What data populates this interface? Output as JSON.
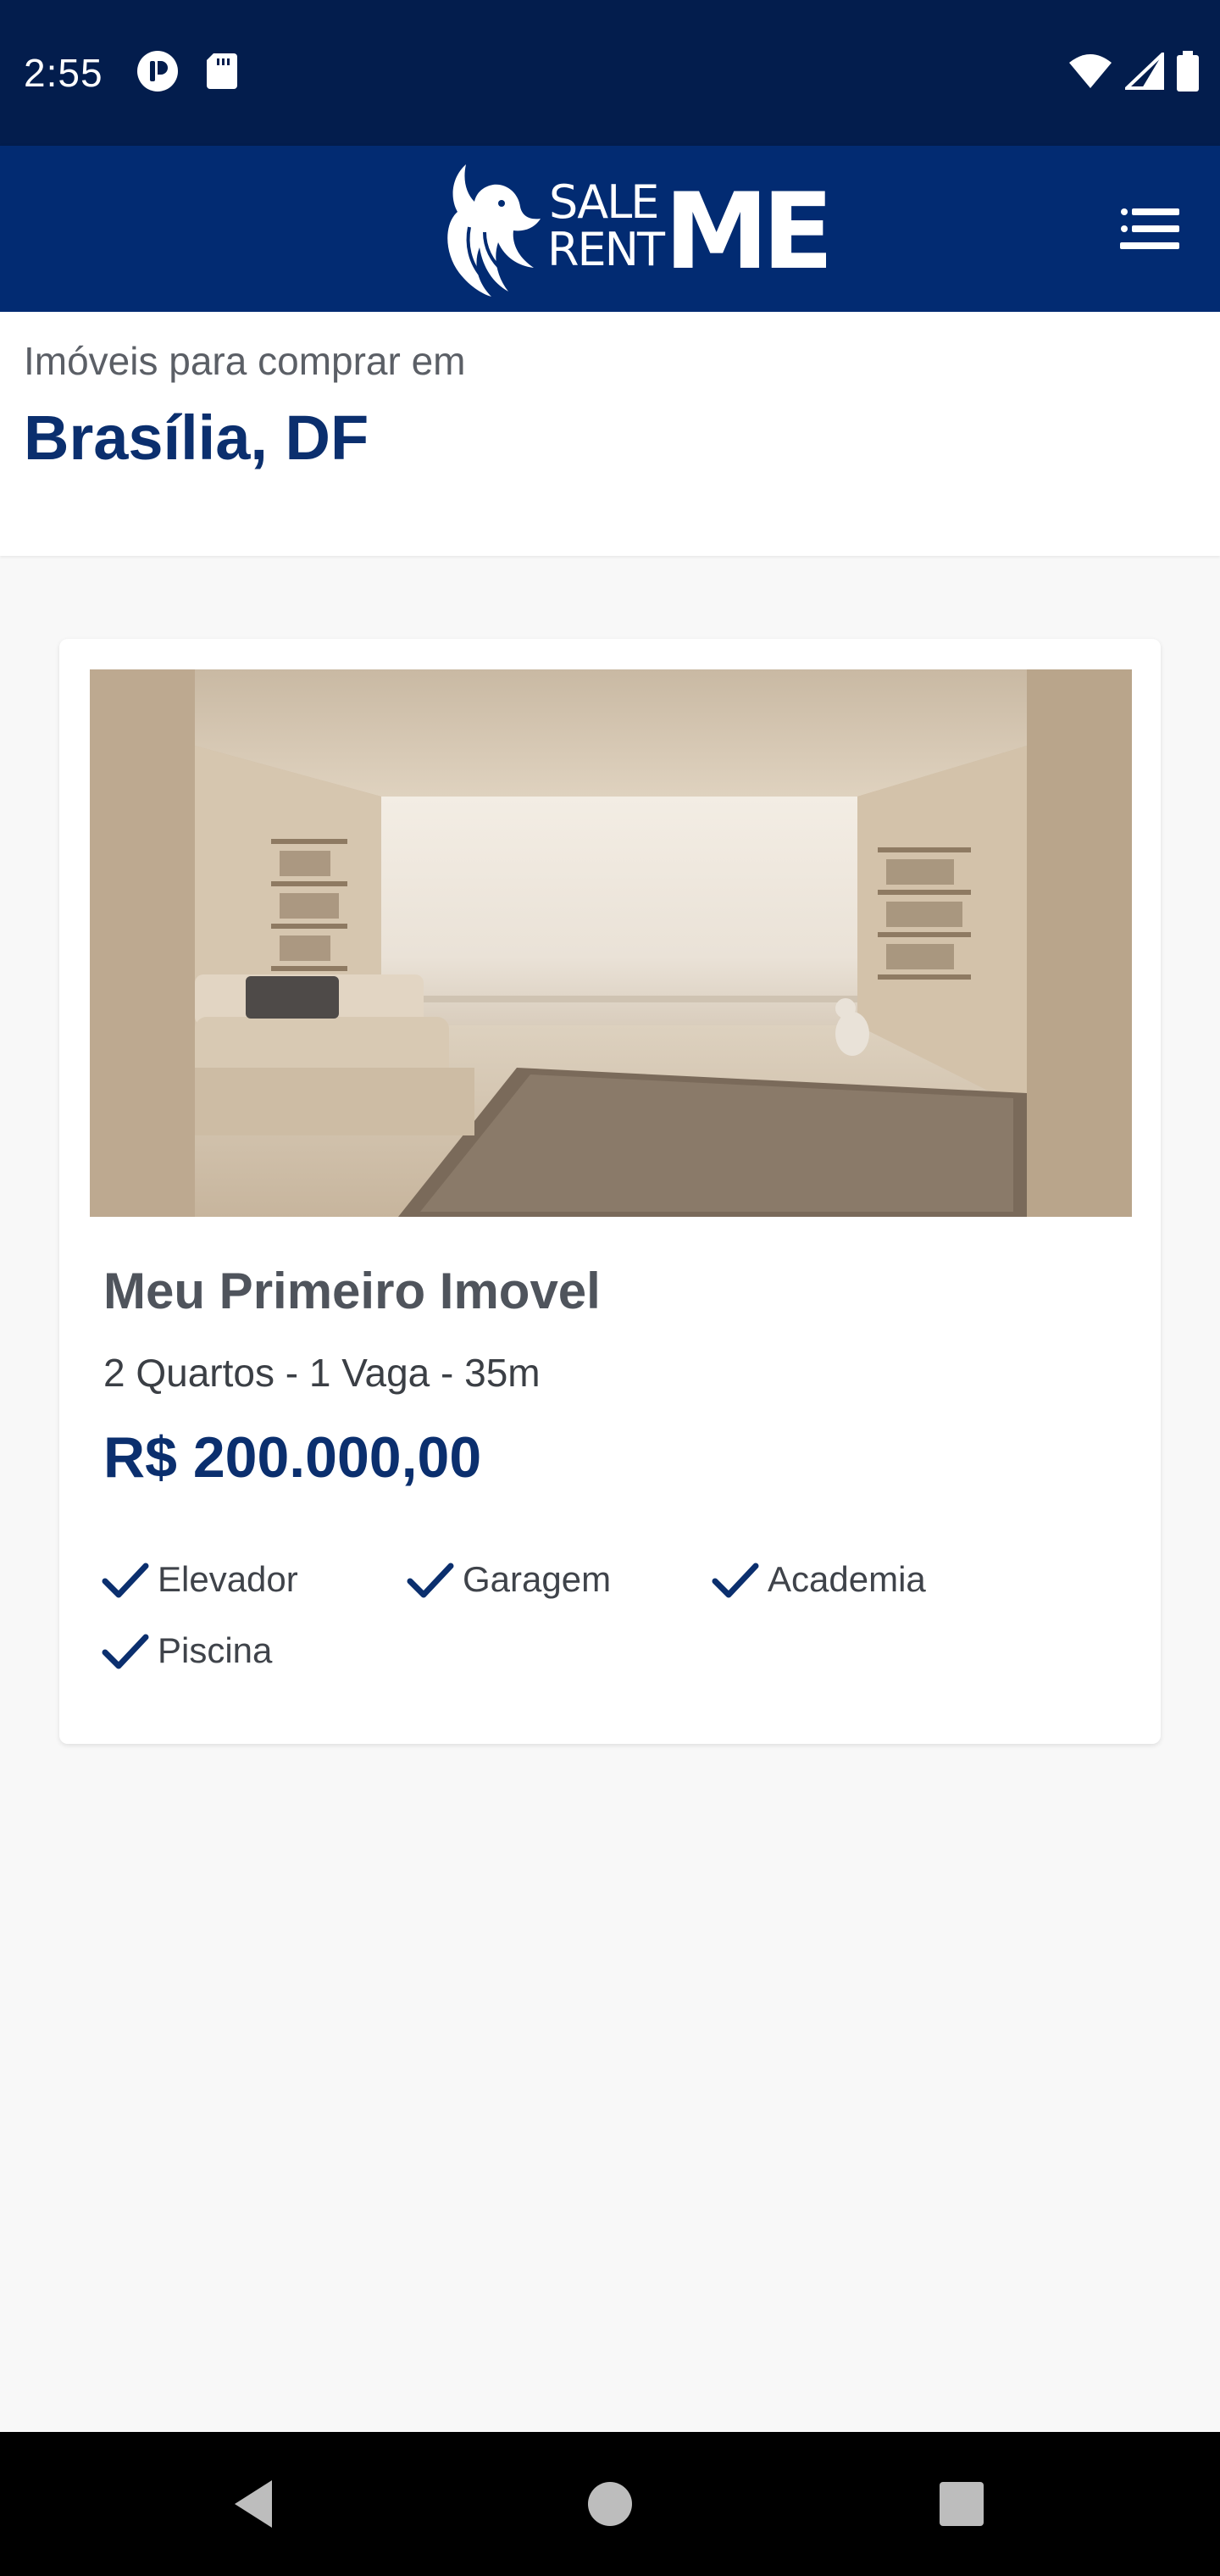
{
  "status_bar": {
    "time": "2:55",
    "left_icons": [
      "notification-icon",
      "sd-card-icon"
    ],
    "right_icons": [
      "wifi-icon",
      "signal-icon",
      "battery-icon"
    ]
  },
  "header": {
    "logo": {
      "line1": "SALE",
      "line2": "RENT",
      "mark": "ME"
    },
    "menu_icon": "hamburger-menu-icon"
  },
  "location": {
    "subtitle": "Imóveis para comprar em",
    "title": "Brasília, DF"
  },
  "listing": {
    "title": "Meu Primeiro Imovel",
    "details": "2 Quartos - 1 Vaga - 35m",
    "price": "R$ 200.000,00",
    "amenities": [
      "Elevador",
      "Garagem",
      "Academia",
      "Piscina"
    ]
  },
  "colors": {
    "status_bar": "#031d4d",
    "header": "#022b72",
    "accent": "#0b2f6e",
    "background": "#f8f8f8"
  },
  "nav": {
    "icons": [
      "back-icon",
      "home-icon",
      "recents-icon"
    ]
  }
}
